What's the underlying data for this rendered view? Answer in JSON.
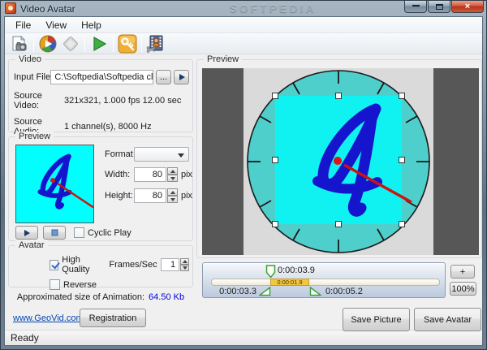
{
  "window": {
    "title": "Video Avatar",
    "watermark": "SOFTPEDIA",
    "status": "Ready",
    "close_glyph": "×"
  },
  "menu": {
    "items": [
      "File",
      "View",
      "Help"
    ]
  },
  "toolbar": {
    "icons": [
      "open-video-icon",
      "media-player-icon",
      "stop-diamond-icon",
      "play-icon",
      "key-icon",
      "avatar-frames-icon"
    ]
  },
  "video_group": {
    "title": "Video",
    "input_file_label": "Input File",
    "input_file_value": "C:\\Softpedia\\Softpedia clock.avi",
    "browse_label": "...",
    "source_video_label": "Source Video:",
    "source_video_value": "321x321, 1.000 fps 12.00 sec",
    "source_audio_label": "Source Audio:",
    "source_audio_value": "1 channel(s), 8000 Hz"
  },
  "preview_group": {
    "title": "Preview",
    "format_label": "Format:",
    "format_value": "",
    "width_label": "Width:",
    "width_value": "80",
    "height_label": "Height:",
    "height_value": "80",
    "unit": "pix",
    "cyclic_play_label": "Cyclic Play"
  },
  "avatar_group": {
    "title": "Avatar",
    "high_quality_label": "High Quality",
    "frames_label": "Frames/Sec",
    "frames_value": "1",
    "reverse_label": "Reverse"
  },
  "size_info": {
    "label": "Approximated size of Animation:",
    "value": "64.50 Kb"
  },
  "footer": {
    "link": "www.GeoVid.com",
    "registration_label": "Registration"
  },
  "right_preview": {
    "title": "Preview"
  },
  "timeline": {
    "position": "0:00:03.9",
    "selection_duration": "0:00:01.9",
    "selection_start": "0:00:03.3",
    "selection_end": "0:00:05.2",
    "zoom_in_label": "+",
    "zoom_level": "100%"
  },
  "actions": {
    "save_picture": "Save Picture",
    "save_avatar": "Save Avatar"
  },
  "colors": {
    "clock_fill": "#4fcfcb",
    "selection_cyan": "#10f2f2",
    "digit_blue": "#1515ce",
    "hand_red": "#d51a1a",
    "highlight_yellow": "#f2c93e",
    "size_value_blue": "#0000e0"
  }
}
